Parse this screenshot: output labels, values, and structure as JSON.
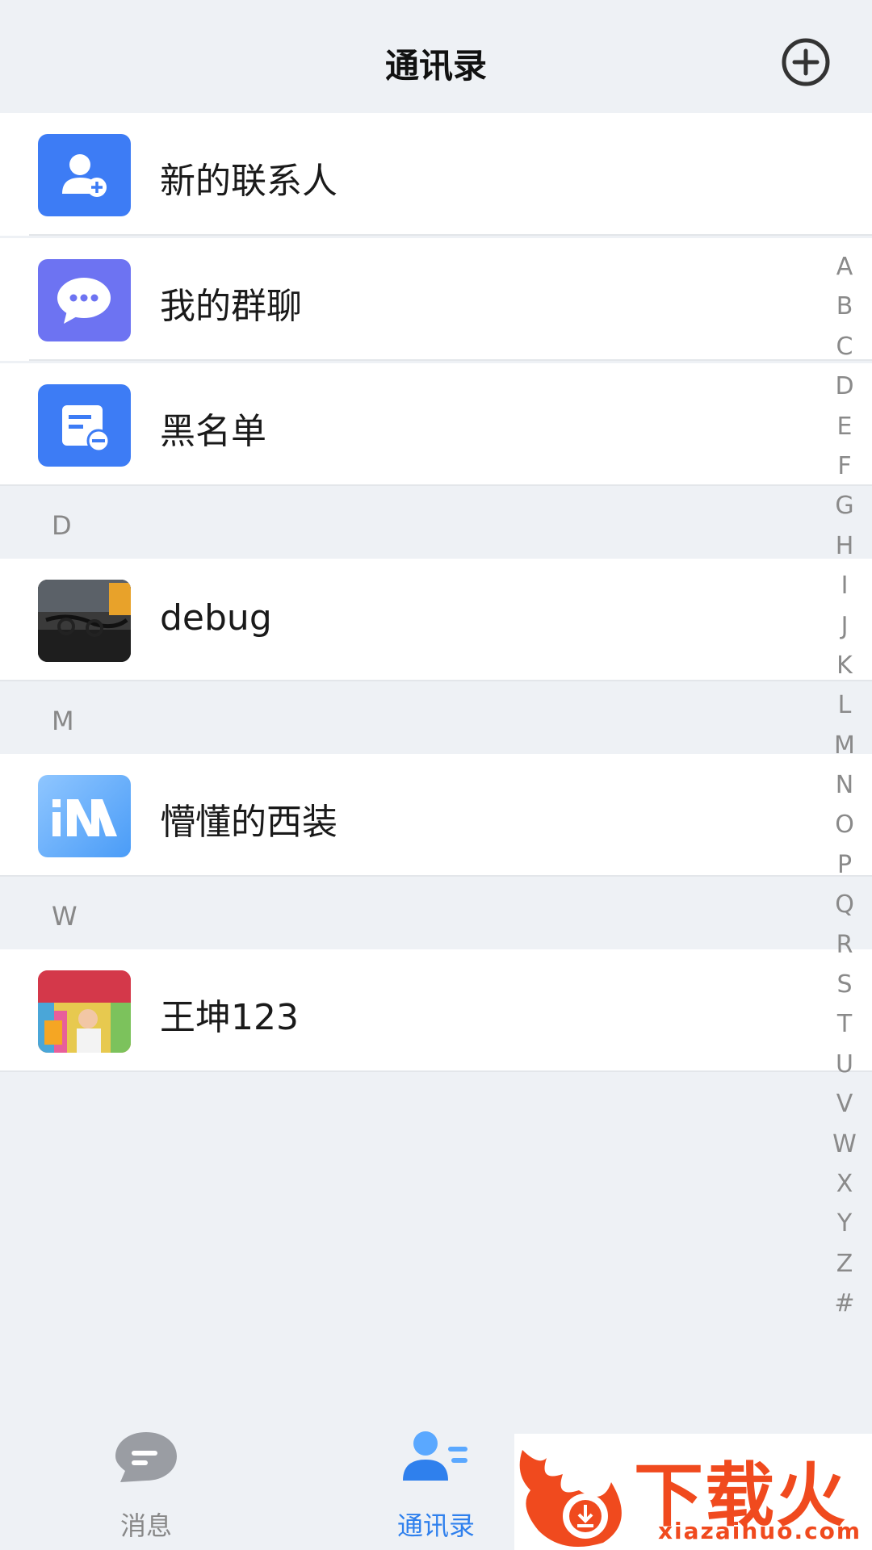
{
  "header": {
    "title": "通讯录",
    "add_icon": "plus-circle-icon"
  },
  "fixed_items": [
    {
      "label": "新的联系人",
      "icon": "add-contact-icon",
      "color": "#3d7cf5"
    },
    {
      "label": "我的群聊",
      "icon": "group-chat-icon",
      "color": "#6d73f2"
    },
    {
      "label": "黑名单",
      "icon": "blacklist-icon",
      "color": "#3d7cf5"
    }
  ],
  "sections": [
    {
      "letter": "D",
      "contacts": [
        {
          "name": "debug"
        }
      ]
    },
    {
      "letter": "M",
      "contacts": [
        {
          "name": "懵懂的西装"
        }
      ]
    },
    {
      "letter": "W",
      "contacts": [
        {
          "name": "王坤123"
        }
      ]
    }
  ],
  "alphabet_index": [
    "A",
    "B",
    "C",
    "D",
    "E",
    "F",
    "G",
    "H",
    "I",
    "J",
    "K",
    "L",
    "M",
    "N",
    "O",
    "P",
    "Q",
    "R",
    "S",
    "T",
    "U",
    "V",
    "W",
    "X",
    "Y",
    "Z",
    "#"
  ],
  "tabbar": {
    "tabs": [
      {
        "label": "消息",
        "icon": "message-icon",
        "active": false
      },
      {
        "label": "通讯录",
        "icon": "contacts-icon",
        "active": true
      }
    ]
  },
  "watermark": {
    "text": "下载火",
    "url": "xiazaihuo.com"
  },
  "colors": {
    "accent": "#2f80ed",
    "background": "#eef1f5",
    "watermark": "#f04a1e"
  }
}
